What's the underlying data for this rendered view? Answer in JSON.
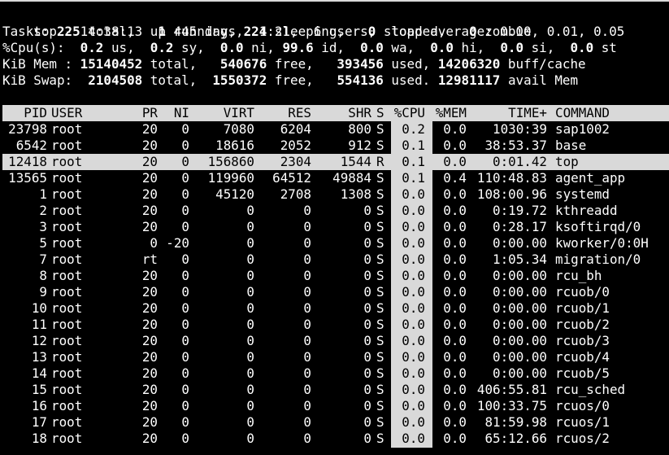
{
  "summary": {
    "line1": {
      "prefix": "top - 14:38:13 up 445 days,  1:21,  6 users,  load average: 0.00, 0.01, 0.05"
    },
    "line2": {
      "label": "Tasks: ",
      "total": "225",
      "total_label": " total,   ",
      "running": "1",
      "running_label": " running, ",
      "sleeping": "224",
      "sleeping_label": " sleeping,   ",
      "stopped": "0",
      "stopped_label": " stopped,   ",
      "zombie": "0",
      "zombie_label": " zombie"
    },
    "line3": {
      "label": "%Cpu(s):  ",
      "us": "0.2",
      "us_label": " us,  ",
      "sy": "0.2",
      "sy_label": " sy,  ",
      "ni": "0.0",
      "ni_label": " ni, ",
      "id": "99.6",
      "id_label": " id,  ",
      "wa": "0.0",
      "wa_label": " wa,  ",
      "hi": "0.0",
      "hi_label": " hi,  ",
      "si": "0.0",
      "si_label": " si,  ",
      "st": "0.0",
      "st_label": " st"
    },
    "line4": {
      "label": "KiB Mem : ",
      "total": "15140452",
      "total_label": " total,   ",
      "free": "540676",
      "free_label": " free,   ",
      "used": "393456",
      "used_label": " used, ",
      "cache": "14206320",
      "cache_label": " buff/cache"
    },
    "line5": {
      "label": "KiB Swap:  ",
      "total": "2104508",
      "total_label": " total,  ",
      "free": "1550372",
      "free_label": " free,   ",
      "used": "554136",
      "used_label": " used. ",
      "avail": "12981117",
      "avail_label": " avail Mem"
    }
  },
  "table": {
    "headers": {
      "pid": "PID",
      "user": "USER",
      "pr": "PR",
      "ni": "NI",
      "virt": "VIRT",
      "res": "RES",
      "shr": "SHR",
      "s": "S",
      "cpu": "%CPU",
      "mem": "%MEM",
      "time": "TIME+",
      "command": "COMMAND"
    },
    "rows": [
      {
        "pid": "23798",
        "user": "root",
        "pr": "20",
        "ni": "0",
        "virt": "7080",
        "res": "6204",
        "shr": "800",
        "s": "S",
        "cpu": "0.2",
        "mem": "0.0",
        "time": "1030:39",
        "command": "sap1002"
      },
      {
        "pid": "6542",
        "user": "root",
        "pr": "20",
        "ni": "0",
        "virt": "18616",
        "res": "2052",
        "shr": "912",
        "s": "S",
        "cpu": "0.1",
        "mem": "0.0",
        "time": "38:53.37",
        "command": "base"
      },
      {
        "pid": "12418",
        "user": "root",
        "pr": "20",
        "ni": "0",
        "virt": "156860",
        "res": "2304",
        "shr": "1544",
        "s": "R",
        "cpu": "0.1",
        "mem": "0.0",
        "time": "0:01.42",
        "command": "top"
      },
      {
        "pid": "13565",
        "user": "root",
        "pr": "20",
        "ni": "0",
        "virt": "119960",
        "res": "64512",
        "shr": "49884",
        "s": "S",
        "cpu": "0.1",
        "mem": "0.4",
        "time": "110:48.83",
        "command": "agent_app"
      },
      {
        "pid": "1",
        "user": "root",
        "pr": "20",
        "ni": "0",
        "virt": "45120",
        "res": "2708",
        "shr": "1308",
        "s": "S",
        "cpu": "0.0",
        "mem": "0.0",
        "time": "108:00.96",
        "command": "systemd"
      },
      {
        "pid": "2",
        "user": "root",
        "pr": "20",
        "ni": "0",
        "virt": "0",
        "res": "0",
        "shr": "0",
        "s": "S",
        "cpu": "0.0",
        "mem": "0.0",
        "time": "0:19.72",
        "command": "kthreadd"
      },
      {
        "pid": "3",
        "user": "root",
        "pr": "20",
        "ni": "0",
        "virt": "0",
        "res": "0",
        "shr": "0",
        "s": "S",
        "cpu": "0.0",
        "mem": "0.0",
        "time": "0:28.17",
        "command": "ksoftirqd/0"
      },
      {
        "pid": "5",
        "user": "root",
        "pr": "0",
        "ni": "-20",
        "virt": "0",
        "res": "0",
        "shr": "0",
        "s": "S",
        "cpu": "0.0",
        "mem": "0.0",
        "time": "0:00.00",
        "command": "kworker/0:0H"
      },
      {
        "pid": "7",
        "user": "root",
        "pr": "rt",
        "ni": "0",
        "virt": "0",
        "res": "0",
        "shr": "0",
        "s": "S",
        "cpu": "0.0",
        "mem": "0.0",
        "time": "1:05.34",
        "command": "migration/0"
      },
      {
        "pid": "8",
        "user": "root",
        "pr": "20",
        "ni": "0",
        "virt": "0",
        "res": "0",
        "shr": "0",
        "s": "S",
        "cpu": "0.0",
        "mem": "0.0",
        "time": "0:00.00",
        "command": "rcu_bh"
      },
      {
        "pid": "9",
        "user": "root",
        "pr": "20",
        "ni": "0",
        "virt": "0",
        "res": "0",
        "shr": "0",
        "s": "S",
        "cpu": "0.0",
        "mem": "0.0",
        "time": "0:00.00",
        "command": "rcuob/0"
      },
      {
        "pid": "10",
        "user": "root",
        "pr": "20",
        "ni": "0",
        "virt": "0",
        "res": "0",
        "shr": "0",
        "s": "S",
        "cpu": "0.0",
        "mem": "0.0",
        "time": "0:00.00",
        "command": "rcuob/1"
      },
      {
        "pid": "11",
        "user": "root",
        "pr": "20",
        "ni": "0",
        "virt": "0",
        "res": "0",
        "shr": "0",
        "s": "S",
        "cpu": "0.0",
        "mem": "0.0",
        "time": "0:00.00",
        "command": "rcuob/2"
      },
      {
        "pid": "12",
        "user": "root",
        "pr": "20",
        "ni": "0",
        "virt": "0",
        "res": "0",
        "shr": "0",
        "s": "S",
        "cpu": "0.0",
        "mem": "0.0",
        "time": "0:00.00",
        "command": "rcuob/3"
      },
      {
        "pid": "13",
        "user": "root",
        "pr": "20",
        "ni": "0",
        "virt": "0",
        "res": "0",
        "shr": "0",
        "s": "S",
        "cpu": "0.0",
        "mem": "0.0",
        "time": "0:00.00",
        "command": "rcuob/4"
      },
      {
        "pid": "14",
        "user": "root",
        "pr": "20",
        "ni": "0",
        "virt": "0",
        "res": "0",
        "shr": "0",
        "s": "S",
        "cpu": "0.0",
        "mem": "0.0",
        "time": "0:00.00",
        "command": "rcuob/5"
      },
      {
        "pid": "15",
        "user": "root",
        "pr": "20",
        "ni": "0",
        "virt": "0",
        "res": "0",
        "shr": "0",
        "s": "S",
        "cpu": "0.0",
        "mem": "0.0",
        "time": "406:55.81",
        "command": "rcu_sched"
      },
      {
        "pid": "16",
        "user": "root",
        "pr": "20",
        "ni": "0",
        "virt": "0",
        "res": "0",
        "shr": "0",
        "s": "S",
        "cpu": "0.0",
        "mem": "0.0",
        "time": "100:33.75",
        "command": "rcuos/0"
      },
      {
        "pid": "17",
        "user": "root",
        "pr": "20",
        "ni": "0",
        "virt": "0",
        "res": "0",
        "shr": "0",
        "s": "S",
        "cpu": "0.0",
        "mem": "0.0",
        "time": "81:59.98",
        "command": "rcuos/1"
      },
      {
        "pid": "18",
        "user": "root",
        "pr": "20",
        "ni": "0",
        "virt": "0",
        "res": "0",
        "shr": "0",
        "s": "S",
        "cpu": "0.0",
        "mem": "0.0",
        "time": "65:12.66",
        "command": "rcuos/2"
      }
    ],
    "selected_pid": "12418"
  },
  "colors": {
    "background": "#000000",
    "foreground": "#ffffff",
    "highlight": "#d9d9d9",
    "highlight_text": "#000000"
  }
}
